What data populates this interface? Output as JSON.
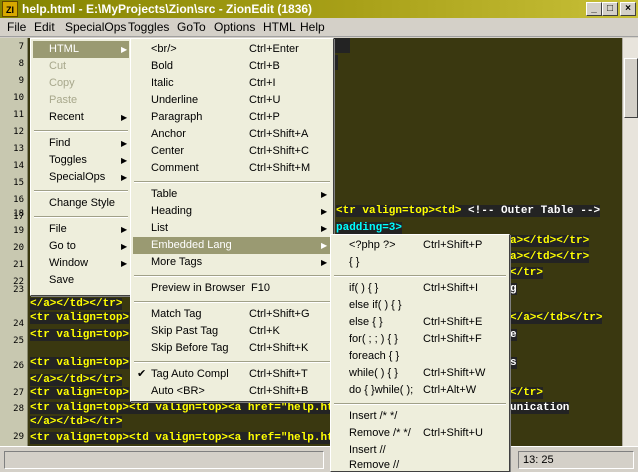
{
  "title": "help.html - E:\\MyProjects\\Zion\\src - ZionEdit  (1836)",
  "app_icon": "ZI",
  "window_buttons": {
    "minimize": "_",
    "maximize": "□",
    "close": "×"
  },
  "menubar": [
    "File",
    "Edit",
    "SpecialOps",
    "Toggles",
    "GoTo",
    "Options",
    "HTML",
    "Help"
  ],
  "gutter": {
    "lines": [
      "7",
      "8",
      "9",
      "10",
      "11",
      "12",
      "13",
      "14",
      "15",
      "16",
      "17",
      "18",
      "19",
      "20",
      "21",
      "22",
      "23",
      "",
      "24",
      "25",
      "",
      "26",
      "",
      "27",
      "28",
      "",
      "29"
    ]
  },
  "code": {
    "l7": "",
    "l18_tag": "<tr valign=top><td>",
    "l18_comment": " <!-- Outer Table -->",
    "l19": "padding=3>",
    "l20": "a></td></tr>",
    "l21": "a></td></tr>",
    "l22": "</tr>",
    "l23": "g",
    "l23b": "</a></td></tr>",
    "l24a": "<tr valign=top>",
    "l24b": "</a></td></tr>",
    "l25a": "<tr valign=top>",
    "l25b": "e",
    "l26a": "<tr valign=top>",
    "l26b": "s",
    "l26c": "</a></td></tr>",
    "l27a": "<tr valign=top>",
    "l27b": "</tr>",
    "l28": "<tr valign=top><td valign=top><a href=\"help.ht",
    "l28b": "unication",
    "l28c": "</a></td></tr>",
    "l29": "<tr valign=top><td valign=top><a href=\"help.ht"
  },
  "statusbar": {
    "position": "13: 25"
  },
  "edit_menu": {
    "items": [
      {
        "label": "HTML",
        "arrow": "▶"
      },
      {
        "label": "Cut"
      },
      {
        "label": "Copy"
      },
      {
        "label": "Paste"
      },
      {
        "label": "Recent",
        "arrow": "▶"
      },
      {
        "label": "Find",
        "arrow": "▶"
      },
      {
        "label": "Toggles",
        "arrow": "▶"
      },
      {
        "label": "SpecialOps",
        "arrow": "▶"
      },
      {
        "label": "Change Style"
      },
      {
        "label": "File",
        "arrow": "▶"
      },
      {
        "label": "Go to",
        "arrow": "▶"
      },
      {
        "label": "Window",
        "arrow": "▶"
      },
      {
        "label": "Save"
      }
    ]
  },
  "html_menu": {
    "items": [
      {
        "label": "<br/>",
        "shortcut": "Ctrl+Enter"
      },
      {
        "label": "Bold",
        "shortcut": "Ctrl+B"
      },
      {
        "label": "Italic",
        "shortcut": "Ctrl+I"
      },
      {
        "label": "Underline",
        "shortcut": "Ctrl+U"
      },
      {
        "label": "Paragraph",
        "shortcut": "Ctrl+P"
      },
      {
        "label": "Anchor",
        "shortcut": "Ctrl+Shift+A"
      },
      {
        "label": "Center",
        "shortcut": "Ctrl+Shift+C"
      },
      {
        "label": "Comment",
        "shortcut": "Ctrl+Shift+M"
      },
      {
        "label": "Table",
        "arrow": "▶"
      },
      {
        "label": "Heading",
        "arrow": "▶"
      },
      {
        "label": "List",
        "arrow": "▶"
      },
      {
        "label": "Embedded Lang",
        "arrow": "▶"
      },
      {
        "label": "More Tags",
        "arrow": "▶"
      },
      {
        "label": "Preview in Browser",
        "shortcut": "F10"
      },
      {
        "label": "Match Tag",
        "shortcut": "Ctrl+Shift+G"
      },
      {
        "label": "Skip Past Tag",
        "shortcut": "Ctrl+K"
      },
      {
        "label": "Skip Before Tag",
        "shortcut": "Ctrl+Shift+K"
      },
      {
        "label": "Tag Auto Compl",
        "shortcut": "Ctrl+Shift+T",
        "check": "✔"
      },
      {
        "label": "Auto <BR>",
        "shortcut": "Ctrl+Shift+B"
      }
    ]
  },
  "embedded_menu": {
    "items": [
      {
        "label": "<?php  ?>",
        "shortcut": "Ctrl+Shift+P"
      },
      {
        "label": "{  }"
      },
      {
        "label": "if(  ) {  }",
        "shortcut": "Ctrl+Shift+I"
      },
      {
        "label": "else if(  ) {  }"
      },
      {
        "label": "else {  }",
        "shortcut": "Ctrl+Shift+E"
      },
      {
        "label": "for( ; ; ) {  }",
        "shortcut": "Ctrl+Shift+F"
      },
      {
        "label": "foreach  {  }"
      },
      {
        "label": "while(  ) {  }",
        "shortcut": "Ctrl+Shift+W"
      },
      {
        "label": "do {  }while(  );",
        "shortcut": "Ctrl+Alt+W"
      },
      {
        "label": "Insert /* */"
      },
      {
        "label": "Remove /* */",
        "shortcut": "Ctrl+Shift+U"
      },
      {
        "label": "Insert //"
      },
      {
        "label": "Remove //"
      }
    ]
  }
}
